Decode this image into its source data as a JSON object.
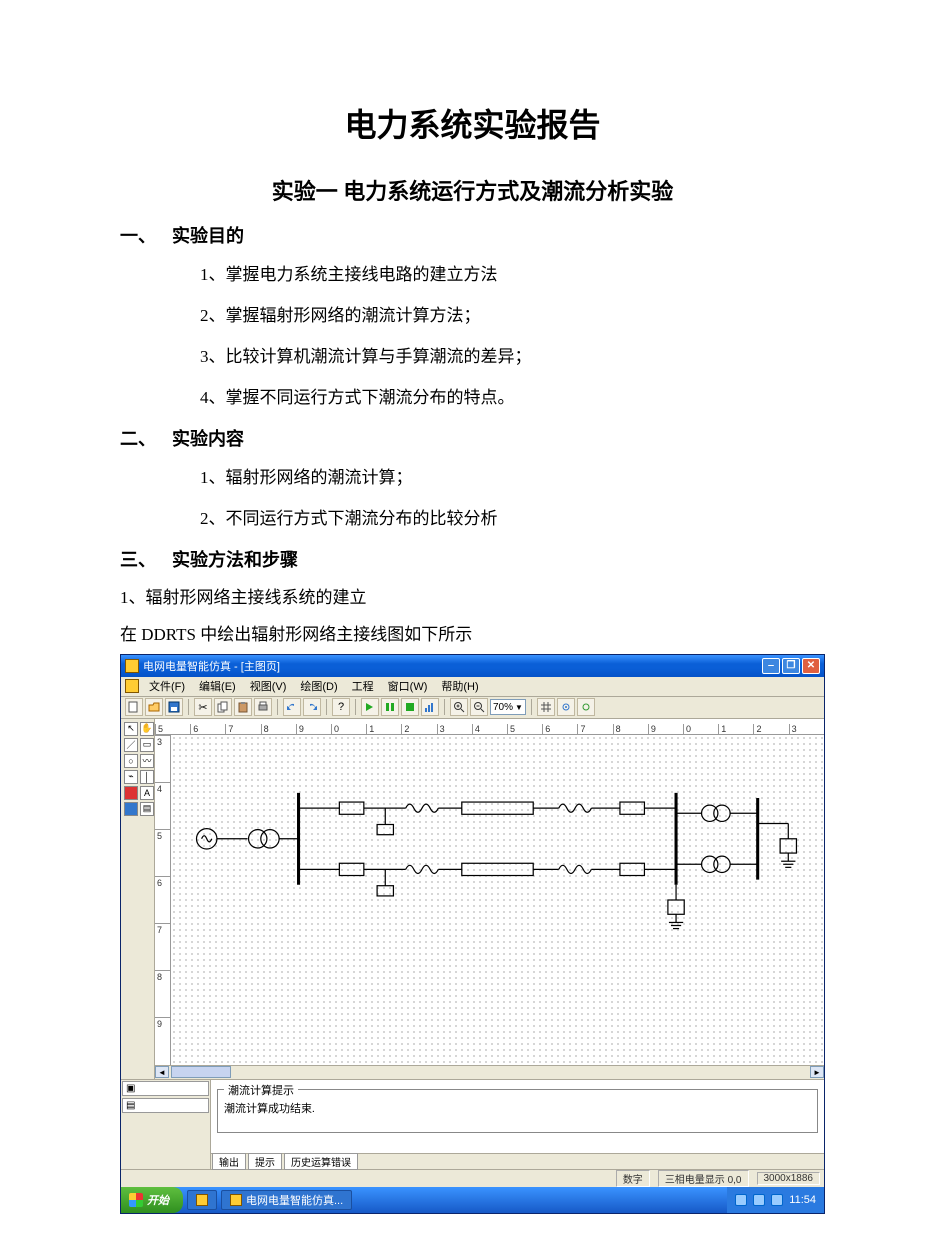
{
  "doc": {
    "title": "电力系统实验报告",
    "subtitle": "实验一 电力系统运行方式及潮流分析实验",
    "sections": {
      "s1": {
        "num": "一、",
        "label": "实验目的"
      },
      "s2": {
        "num": "二、",
        "label": "实验内容"
      },
      "s3": {
        "num": "三、",
        "label": "实验方法和步骤"
      }
    },
    "s1_items": [
      "1、掌握电力系统主接线电路的建立方法",
      "2、掌握辐射形网络的潮流计算方法；",
      "3、比较计算机潮流计算与手算潮流的差异；",
      "4、掌握不同运行方式下潮流分布的特点。"
    ],
    "s2_items": [
      "1、辐射形网络的潮流计算；",
      "2、不同运行方式下潮流分布的比较分析"
    ],
    "s3_step1": "1、辐射形网络主接线系统的建立",
    "s3_caption": "在 DDRTS 中绘出辐射形网络主接线图如下所示"
  },
  "app": {
    "title": "电网电量智能仿真 - [主图页]",
    "menu": [
      "文件(F)",
      "编辑(E)",
      "视图(V)",
      "绘图(D)",
      "工程",
      "窗口(W)",
      "帮助(H)"
    ],
    "zoom": "70%",
    "ruler_h": [
      "5",
      "6",
      "7",
      "8",
      "9",
      "0",
      "1",
      "2",
      "3",
      "4",
      "5",
      "6",
      "7",
      "8",
      "9",
      "0",
      "1",
      "2",
      "3"
    ],
    "ruler_v": [
      "3",
      "4",
      "5",
      "6",
      "7",
      "8",
      "9"
    ],
    "panel_title": "潮流计算提示",
    "panel_line": "潮流计算成功结束.",
    "foot_tabs": [
      "输出",
      "提示",
      "历史运算错误"
    ],
    "status": {
      "label1": "数字",
      "label2": "三相电量显示",
      "val2": "0,0",
      "dim": "3000x1886"
    },
    "taskbar": {
      "start": "开始",
      "task1_label": "电网电量智能仿真...",
      "clock": "11:54"
    }
  }
}
